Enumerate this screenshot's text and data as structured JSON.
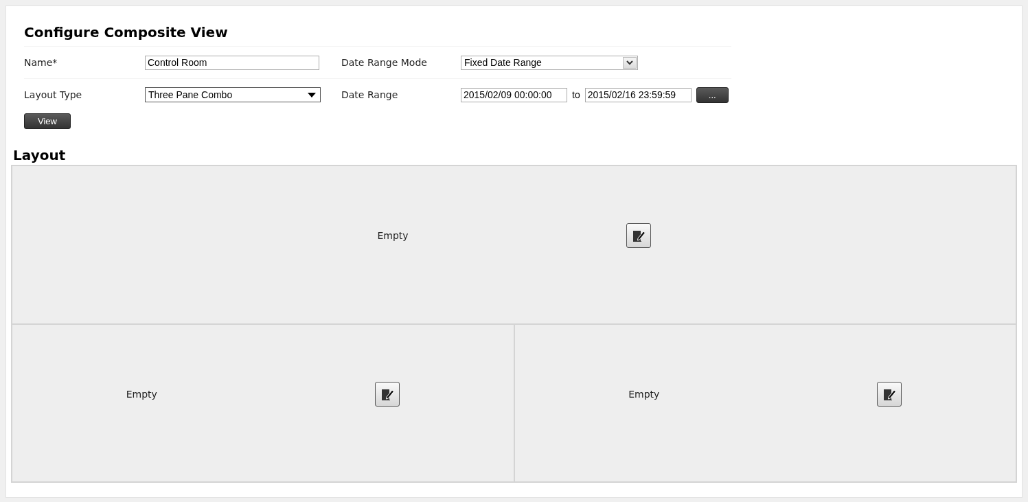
{
  "title": "Configure Composite View",
  "form_rows": [
    {
      "fields": [
        {
          "label": "Name*",
          "kind": "text",
          "value": "Control Room"
        },
        {
          "label": "Date Range Mode",
          "kind": "dropdown",
          "value": "Fixed Date Range"
        }
      ]
    },
    {
      "fields": [
        {
          "label": "Layout Type",
          "kind": "select",
          "value": "Three Pane Combo"
        },
        {
          "label": "Date Range",
          "kind": "date_range",
          "from": "2015/02/09 00:00:00",
          "separator": "to",
          "until": "2015/02/16 23:59:59",
          "button": "..."
        }
      ]
    }
  ],
  "view_button": "View",
  "layout": {
    "heading": "Layout",
    "rows": [
      {
        "panes": [
          {
            "label": "Empty"
          }
        ]
      },
      {
        "panes": [
          {
            "label": "Empty"
          },
          {
            "label": "Empty"
          }
        ]
      }
    ]
  }
}
